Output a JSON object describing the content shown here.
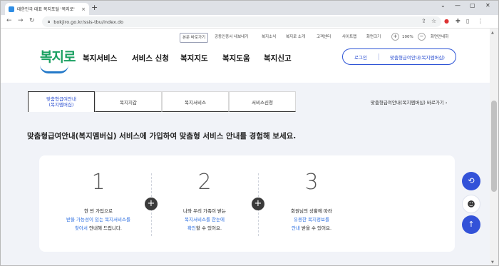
{
  "browser": {
    "tab_title": "대한민국 대표 복지포털 '복지로'",
    "tab_close": "×",
    "new_tab": "+",
    "window_controls": [
      "⌄",
      "—",
      "▢",
      "✕"
    ],
    "url": "bokjiro.go.kr/ssis-tbu/index.do"
  },
  "utility": {
    "items": [
      "본문 바로가기",
      "공동인증서 내보내기",
      "복지소식",
      "복지로 소개",
      "고객센터",
      "사이트맵",
      "화면크기"
    ],
    "zoom_in": "+",
    "zoom_level": "100%",
    "zoom_out": "−",
    "zoom_reset": "화면안내하"
  },
  "header": {
    "logo": "복지로",
    "gnb": [
      "복지서비스",
      "서비스 신청",
      "복지지도",
      "복지도움",
      "복지신고"
    ],
    "login": "로그인",
    "membership": "맞춤형급여안내(복지멤버십)"
  },
  "subtabs": {
    "active_line1": "맞춤형급여안내",
    "active_line2": "(복지멤버십)",
    "items": [
      "복지지갑",
      "복지서비스",
      "서비스신청"
    ],
    "shortcut": "맞춤형급여안내(복지멤버십) 바로가기 ›"
  },
  "main": {
    "headline": "맞춤형급여안내(복지멤버십) 서비스에 가입하여 맞춤형 서비스 안내를 경험해 보세요.",
    "steps": [
      {
        "num": "1",
        "l1": "한 번 가입으로",
        "l2": "받을 가능성이 있는 복지서비스를",
        "l3a": "찾아서",
        "l3b": " 안내해 드립니다."
      },
      {
        "num": "2",
        "l1": "나와 우리 가족이 받는",
        "l2": "복지서비스를 한눈에",
        "l3a": "확인",
        "l3b": "할 수 있어요."
      },
      {
        "num": "3",
        "l1": "회원님의 상황에 따라",
        "l2": "유용한 복지정보를",
        "l3a": "안내",
        "l3b": " 받을 수 있어요."
      }
    ],
    "plus": "+"
  },
  "colors": {
    "accent": "#2a4ed0",
    "logo_green": "#1aa061",
    "content_bg": "#f1f3f8"
  }
}
